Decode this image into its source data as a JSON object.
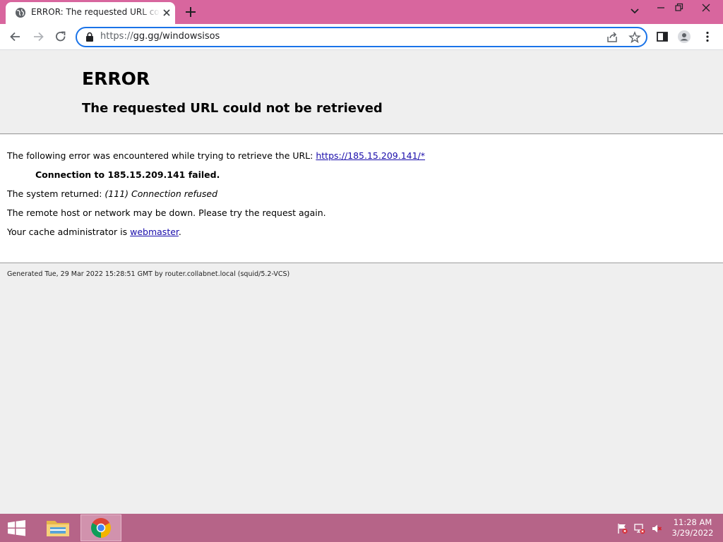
{
  "browser": {
    "tab": {
      "title": "ERROR: The requested URL could not be retrieved",
      "favicon": "globe-icon"
    },
    "omnibox": {
      "scheme": "https://",
      "host_path": "gg.gg/windowsisos"
    },
    "colors": {
      "titlebar": "#d8669e",
      "focus_ring": "#1a73e8"
    }
  },
  "page": {
    "title": "ERROR",
    "subtitle": "The requested URL could not be retrieved",
    "intro_text": "The following error was encountered while trying to retrieve the URL: ",
    "intro_link": "https://185.15.209.141/*",
    "failure": "Connection to 185.15.209.141 failed.",
    "system_returned_label": "The system returned: ",
    "system_returned_value": "(111) Connection refused",
    "remote_host_text": "The remote host or network may be down. Please try the request again.",
    "cache_admin_text": "Your cache administrator is ",
    "cache_admin_link": "webmaster",
    "cache_admin_end": ".",
    "generated": "Generated Tue, 29 Mar 2022 15:28:51 GMT by router.collabnet.local (squid/5.2-VCS)"
  },
  "taskbar": {
    "clock_time": "11:28 AM",
    "clock_date": "3/29/2022",
    "apps": [
      "file-explorer-icon",
      "chrome-icon"
    ],
    "tray": [
      "action-center-flag-icon",
      "network-icon",
      "volume-muted-icon"
    ],
    "color": "#b66488"
  }
}
